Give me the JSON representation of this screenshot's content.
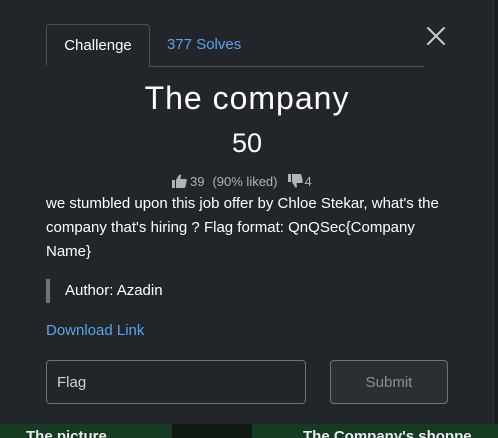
{
  "background": {
    "cards": [
      {
        "title": "The picture"
      },
      {
        "title": "The Company's shoppe"
      }
    ]
  },
  "modal": {
    "close_icon": "close-icon",
    "tabs": [
      {
        "label": "Challenge",
        "active": true
      },
      {
        "label": "377 Solves",
        "active": false
      }
    ],
    "title": "The company",
    "points": "50",
    "rating": {
      "likes": "39",
      "liked_percent": "(90% liked)",
      "dislikes": "4",
      "like_icon": "thumbs-up-icon",
      "dislike_icon": "thumbs-down-icon"
    },
    "description": "we stumbled upon this job offer by Chloe Stekar, what's the company that's hiring ? Flag format: QnQSec{Company Name}",
    "author": "Author: Azadin",
    "download_link": "Download Link",
    "flag_input": {
      "placeholder": "Flag",
      "value": ""
    },
    "submit_label": "Submit"
  },
  "colors": {
    "modal_bg": "#222529",
    "link": "#5ba4e6",
    "text": "#ffffff",
    "muted": "#aeb4ba",
    "backdrop_card": "#163a22"
  }
}
